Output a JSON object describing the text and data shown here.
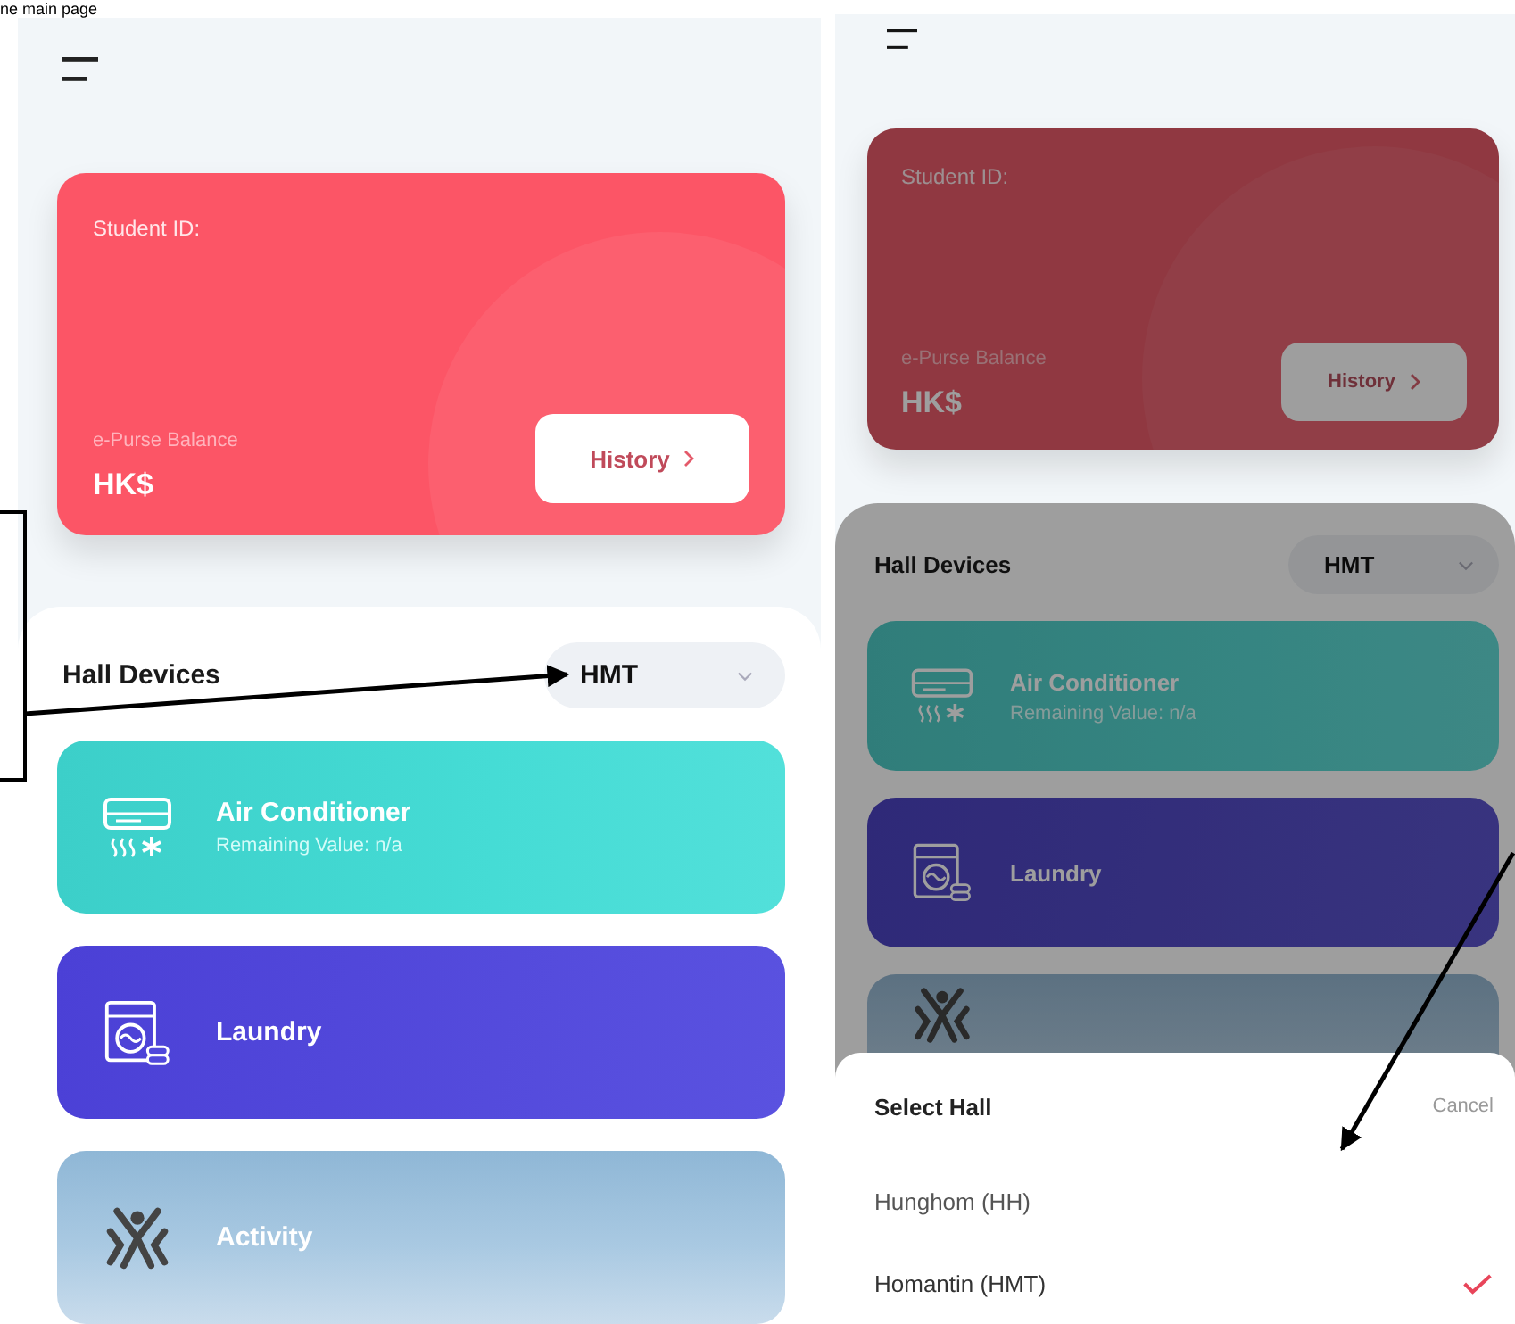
{
  "caption": "ne main page",
  "main_screen": {
    "card": {
      "student_id_label": "Student ID:",
      "balance_label": "e-Purse Balance",
      "currency": "HK$",
      "history_button": "History"
    },
    "hall_devices": {
      "title": "Hall Devices",
      "hall_picker": "HMT"
    },
    "devices": [
      {
        "kind": "air_conditioner",
        "name": "Air Conditioner",
        "detail": "Remaining Value: n/a"
      },
      {
        "kind": "laundry",
        "name": "Laundry"
      },
      {
        "kind": "activity",
        "name": "Activity"
      }
    ]
  },
  "select_hall_screen": {
    "card": {
      "student_id_label": "Student ID:",
      "balance_label": "e-Purse Balance",
      "currency": "HK$",
      "history_button": "History"
    },
    "hall_devices": {
      "title": "Hall Devices",
      "hall_picker": "HMT"
    },
    "devices": [
      {
        "kind": "air_conditioner",
        "name": "Air Conditioner",
        "detail": "Remaining Value: n/a"
      },
      {
        "kind": "laundry",
        "name": "Laundry"
      },
      {
        "kind": "activity"
      }
    ],
    "select_hall_sheet": {
      "title": "Select Hall",
      "cancel": "Cancel",
      "options": [
        {
          "label": "Hunghom (HH)",
          "selected": false
        },
        {
          "label": "Homantin (HMT)",
          "selected": true
        }
      ]
    }
  }
}
